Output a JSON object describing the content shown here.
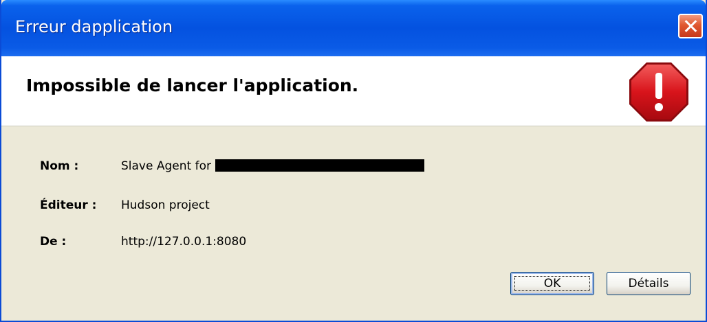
{
  "window": {
    "title": "Erreur dapplication"
  },
  "header": {
    "heading": "Impossible de lancer l'application."
  },
  "details": {
    "name_label": "Nom :",
    "name_value": "Slave Agent for",
    "publisher_label": "Éditeur :",
    "publisher_value": "Hudson project",
    "from_label": "De :",
    "from_value": "http://127.0.0.1:8080"
  },
  "buttons": {
    "ok_label": "OK",
    "details_label": "Détails"
  },
  "icons": {
    "title_close": "close-icon",
    "header": "error-stop-icon"
  },
  "colors": {
    "titlebar": "#0452e0",
    "dialog_bg": "#ece9d8",
    "error_red": "#d8141b"
  }
}
